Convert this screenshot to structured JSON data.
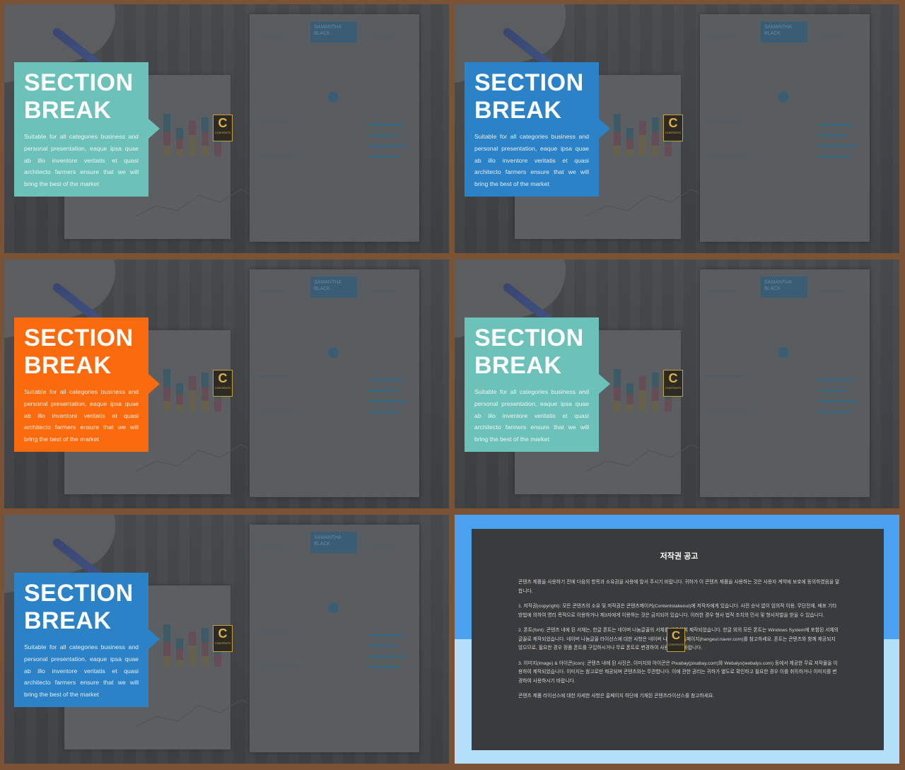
{
  "section": {
    "title": "SECTION\nBREAK",
    "body": "Suitable for all categories business and personal presentation, eaque ipsa quae ab illo inventore veritatis et quasi architecto farmers ensure that we will bring the best of the market"
  },
  "resume_name": "SAMANTHA BLACK",
  "badge_letter": "C",
  "badge_word": "CONTENTS",
  "colors": {
    "teal": "#6cc1b9",
    "blue": "#2b82c7",
    "orange": "#fb6a0c",
    "copyright_outer_top": "#4aa1ef",
    "copyright_outer_bottom": "#b5e0fb",
    "copyright_inner": "#3a3b3c"
  },
  "slides": [
    {
      "id": "slide-1",
      "color": "teal"
    },
    {
      "id": "slide-2",
      "color": "blue"
    },
    {
      "id": "slide-3",
      "color": "orange"
    },
    {
      "id": "slide-4",
      "color": "teal"
    },
    {
      "id": "slide-5",
      "color": "blue"
    }
  ],
  "copyright": {
    "title": "저작권 공고",
    "intro": "콘텐츠 제품을 사용하기 전에 다음의 항목과 소유권을 사용에 앞서 주시기 바랍니다. 귀하가 이 콘텐츠 제품을 사용하는 것은 사용자 계약에 보호에 동의하였음을 말합니다.",
    "p1": "1. 저작권(copyright): 모든 콘텐츠의 소유 및 저작권은 콘텐츠메이커(Contentstakeout)에 저작자에게 있습니다. 사전 승낙 없이 임의적 이용, 무단전재, 배포 기타 방법에 의하여 영리 목적으로 이용하거나 제3자에게 이용하는 것은 금지되어 있습니다. 이러한 경우 형사 법적 조치의 민사 및 형사처벌을 받을 수 있습니다.",
    "p2": "2. 폰트(font): 콘텐츠 내에 된 서체는, 한글 폰트는 네이버 나눔글꼴의 서체를 사용하여 제작되었습니다. 한글 외의 모든 폰트는 Windows System에 포함된 서체의 글꼴로 제작되었습니다. 네이버 나눔글꼴 라이선스에 대한 사항은 네이버 나눔글꼴 홈페이지(hangeul.naver.com)를 참고하세요. 폰트는 콘텐츠와 함께 제공되지 않으므로, 필요한 경우 정품 폰트를 구입하시거나 무료 폰트로 변경하여 사용하시기 바랍니다.",
    "p3": "3. 이미지(image) & 아이콘(icon): 콘텐츠 내에 된 사진은, 이미지와 아이콘은 Pixabay(pixabay.com)와 Webalys(webalys.com) 등에서 제공한 무료 저작물을 이용하여 제작되었습니다. 이미지는 참고로만 제공되며 콘텐츠와는 무관합니다. 이에 관한 권리는 귀하가 별도로 확인하고 필요한 경우 이를 취득하거나 이미지를 변경하여 사용하시기 바랍니다.",
    "p4": "콘텐츠 제품 라이선스에 대한 자세한 사항은 홈페이지 하단에 기재된 콘텐츠라이선스를 참고하세요."
  }
}
